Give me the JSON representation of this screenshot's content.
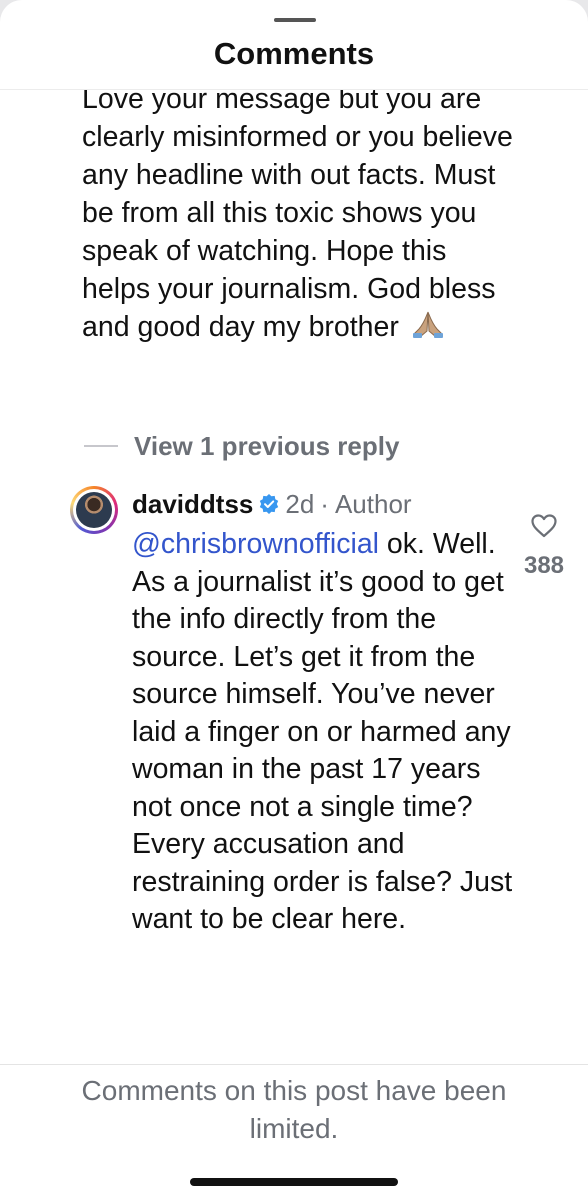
{
  "sheet": {
    "title": "Comments"
  },
  "previous_comment": {
    "text": "Love your message but you are clearly misinformed or you believe any headline with out facts. Must be from all this toxic shows you speak of watching. Hope this helps your journalism. God bless and good day my brother",
    "emoji": "folded-hands-emoji"
  },
  "replies_toggle": {
    "label": "View 1 previous reply"
  },
  "reply": {
    "username": "daviddtss",
    "verified": true,
    "time": "2d",
    "separator": "·",
    "role": "Author",
    "mention": "@chrisbrownofficial",
    "text": " ok. Well. As a journalist it’s good to get the info directly from the source. Let’s get it from the source himself. You’ve never laid a finger on or harmed any woman in the past 17 years not once not a single time? Every accusation and restraining order is false? Just want to be clear here.",
    "likes": "388"
  },
  "footer": {
    "notice": "Comments on this post have been limited."
  },
  "colors": {
    "secondary_text": "#6b6f76",
    "mention": "#3355cc",
    "verified_badge": "#3897f0",
    "background": "#ffffff"
  }
}
